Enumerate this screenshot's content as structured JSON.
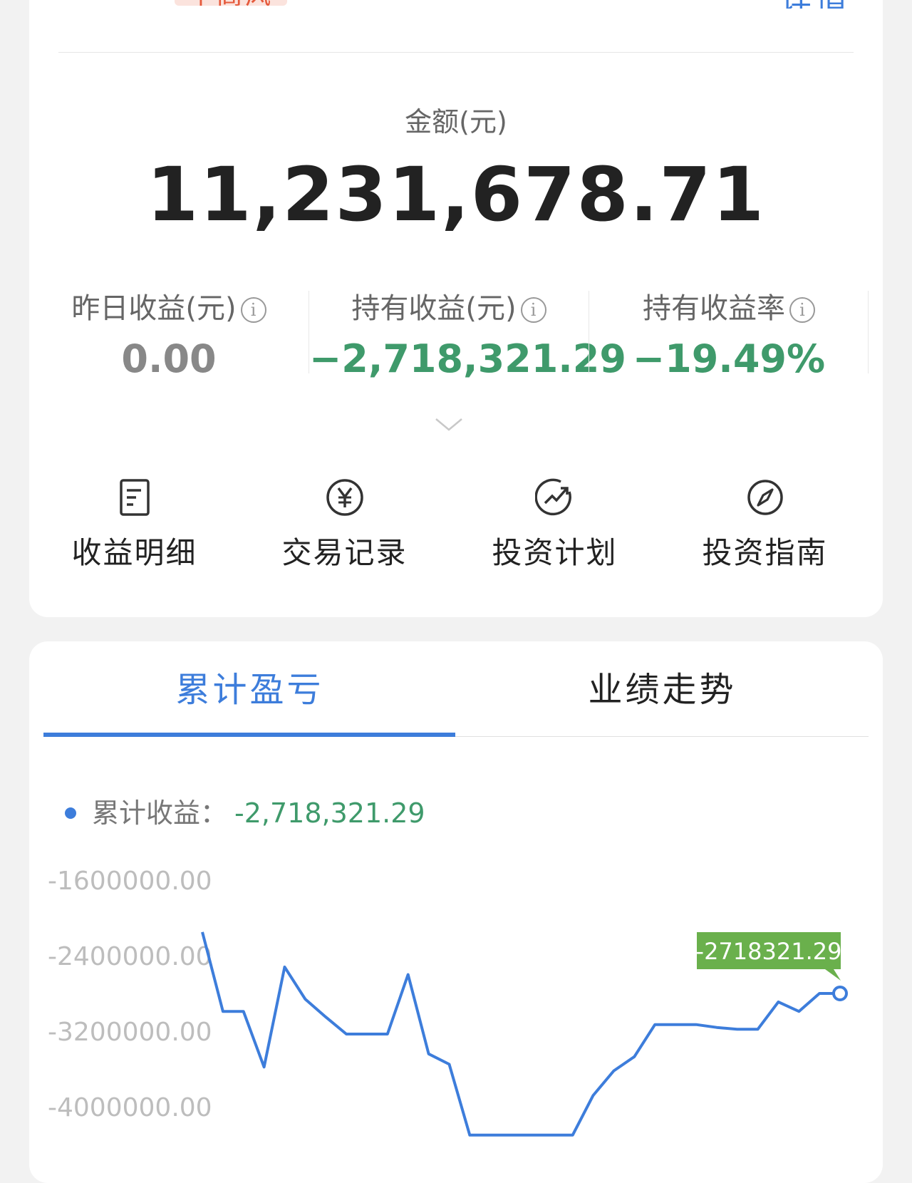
{
  "header": {
    "badge_text": "中高风险",
    "details_link": "详情"
  },
  "asset": {
    "amount_label": "金额(元)",
    "amount_value": "11,231,678.71"
  },
  "stats": [
    {
      "label": "昨日收益(元)",
      "value": "0.00",
      "tone": "neutral"
    },
    {
      "label": "持有收益(元)",
      "value": "−2,718,321.29",
      "tone": "loss"
    },
    {
      "label": "持有收益率",
      "value": "−19.49%",
      "tone": "loss"
    }
  ],
  "actions": [
    {
      "label": "收益明细",
      "icon": "document-icon"
    },
    {
      "label": "交易记录",
      "icon": "yuan-circle-icon"
    },
    {
      "label": "投资计划",
      "icon": "trend-up-circle-icon"
    },
    {
      "label": "投资指南",
      "icon": "compass-icon"
    }
  ],
  "tabs": [
    {
      "label": "累计盈亏",
      "active": true
    },
    {
      "label": "业绩走势",
      "active": false
    }
  ],
  "legend": {
    "label": "累计收益：",
    "value": "-2,718,321.29"
  },
  "colors": {
    "accent": "#3d7ddb",
    "loss_green": "#3f9a6b",
    "tooltip_green": "#6ab04c"
  },
  "chart_data": {
    "type": "line",
    "ytick_labels": [
      "-1600000.00",
      "-2400000.00",
      "-3200000.00",
      "-4000000.00"
    ],
    "yticks": [
      -1600000,
      -2400000,
      -3200000,
      -4000000
    ],
    "ylim": [
      -4000000,
      -1600000
    ],
    "series": [
      {
        "values": [
          -2150000,
          -2990000,
          -2990000,
          -3580000,
          -2520000,
          -2860000,
          -3050000,
          -3230000,
          -3230000,
          -3230000,
          -2600000,
          -3440000,
          -3550000,
          -4300000,
          -4300000,
          -4300000,
          -4300000,
          -4300000,
          -4300000,
          -3880000,
          -3620000,
          -3470000,
          -3130000,
          -3130000,
          -3130000,
          -3160000,
          -3180000,
          -3180000,
          -2890000,
          -2990000,
          -2800000,
          -2800000
        ]
      }
    ],
    "highlight": {
      "index": 31,
      "label": "-2718321.29"
    }
  }
}
